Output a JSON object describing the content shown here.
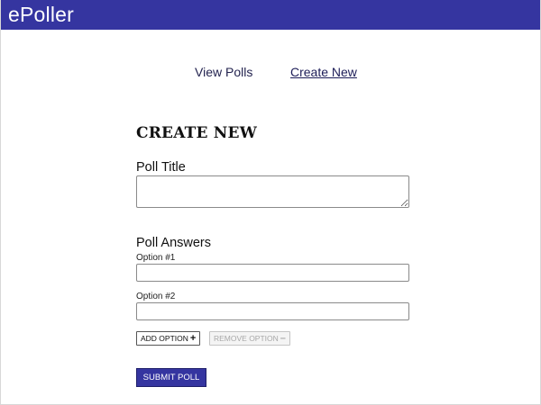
{
  "header": {
    "brand": "ePoller",
    "background_color": "#3535a0"
  },
  "nav": {
    "view_polls": "View Polls",
    "create_new": "Create New",
    "active": "create_new"
  },
  "form": {
    "heading": "CREATE NEW",
    "poll_title_label": "Poll Title",
    "poll_title_value": "",
    "poll_answers_label": "Poll Answers",
    "options": [
      {
        "label": "Option #1",
        "value": ""
      },
      {
        "label": "Option #2",
        "value": ""
      }
    ],
    "add_option_label": "ADD OPTION",
    "add_option_icon": "plus-icon",
    "remove_option_label": "REMOVE OPTION",
    "remove_option_icon": "minus-icon",
    "remove_option_disabled": true,
    "submit_label": "SUBMIT POLL"
  }
}
